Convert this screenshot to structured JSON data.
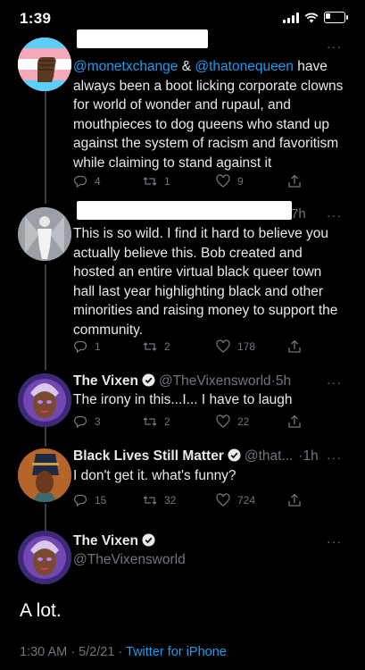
{
  "status_bar": {
    "time": "1:39"
  },
  "tweets": [
    {
      "handle": "",
      "text_pre": "",
      "mention_1": "@monetxchange",
      "text_mid": " & ",
      "mention_2": "@thatonequeen",
      "text_post": " have always been a boot licking corporate clowns for world of wonder and rupaul, and mouthpieces to dog queens who stand up against the system of racism and favoritism while claiming to stand against it",
      "replies": "4",
      "retweets": "1",
      "likes": "9"
    },
    {
      "time_fragment": "7h",
      "text": "This is so wild. I find it hard to believe you actually believe this. Bob created and hosted an entire virtual black queer town hall last year highlighting black and other minorities and raising money to support the community.",
      "replies": "1",
      "retweets": "2",
      "likes": "178"
    },
    {
      "name": "The Vixen",
      "handle": "@TheVixensworld",
      "sep": "·",
      "time": "5h",
      "text": "The irony in this...I... I have to laugh",
      "replies": "3",
      "retweets": "2",
      "likes": "22"
    },
    {
      "name": "Black Lives Still Matter",
      "handle": "@that...",
      "sep": "·",
      "time": "1h",
      "text": "I don't get it. what's funny?",
      "replies": "15",
      "retweets": "32",
      "likes": "724"
    }
  ],
  "main_tweet": {
    "name": "The Vixen",
    "handle": "@TheVixensworld",
    "text": "A lot.",
    "timestamp": "1:30 AM · 5/2/21 · ",
    "source": "Twitter for iPhone"
  },
  "more_glyph": "···",
  "colors": {
    "accent": "#1d9bf0",
    "muted": "#6e767d",
    "line": "#3a3f44"
  }
}
